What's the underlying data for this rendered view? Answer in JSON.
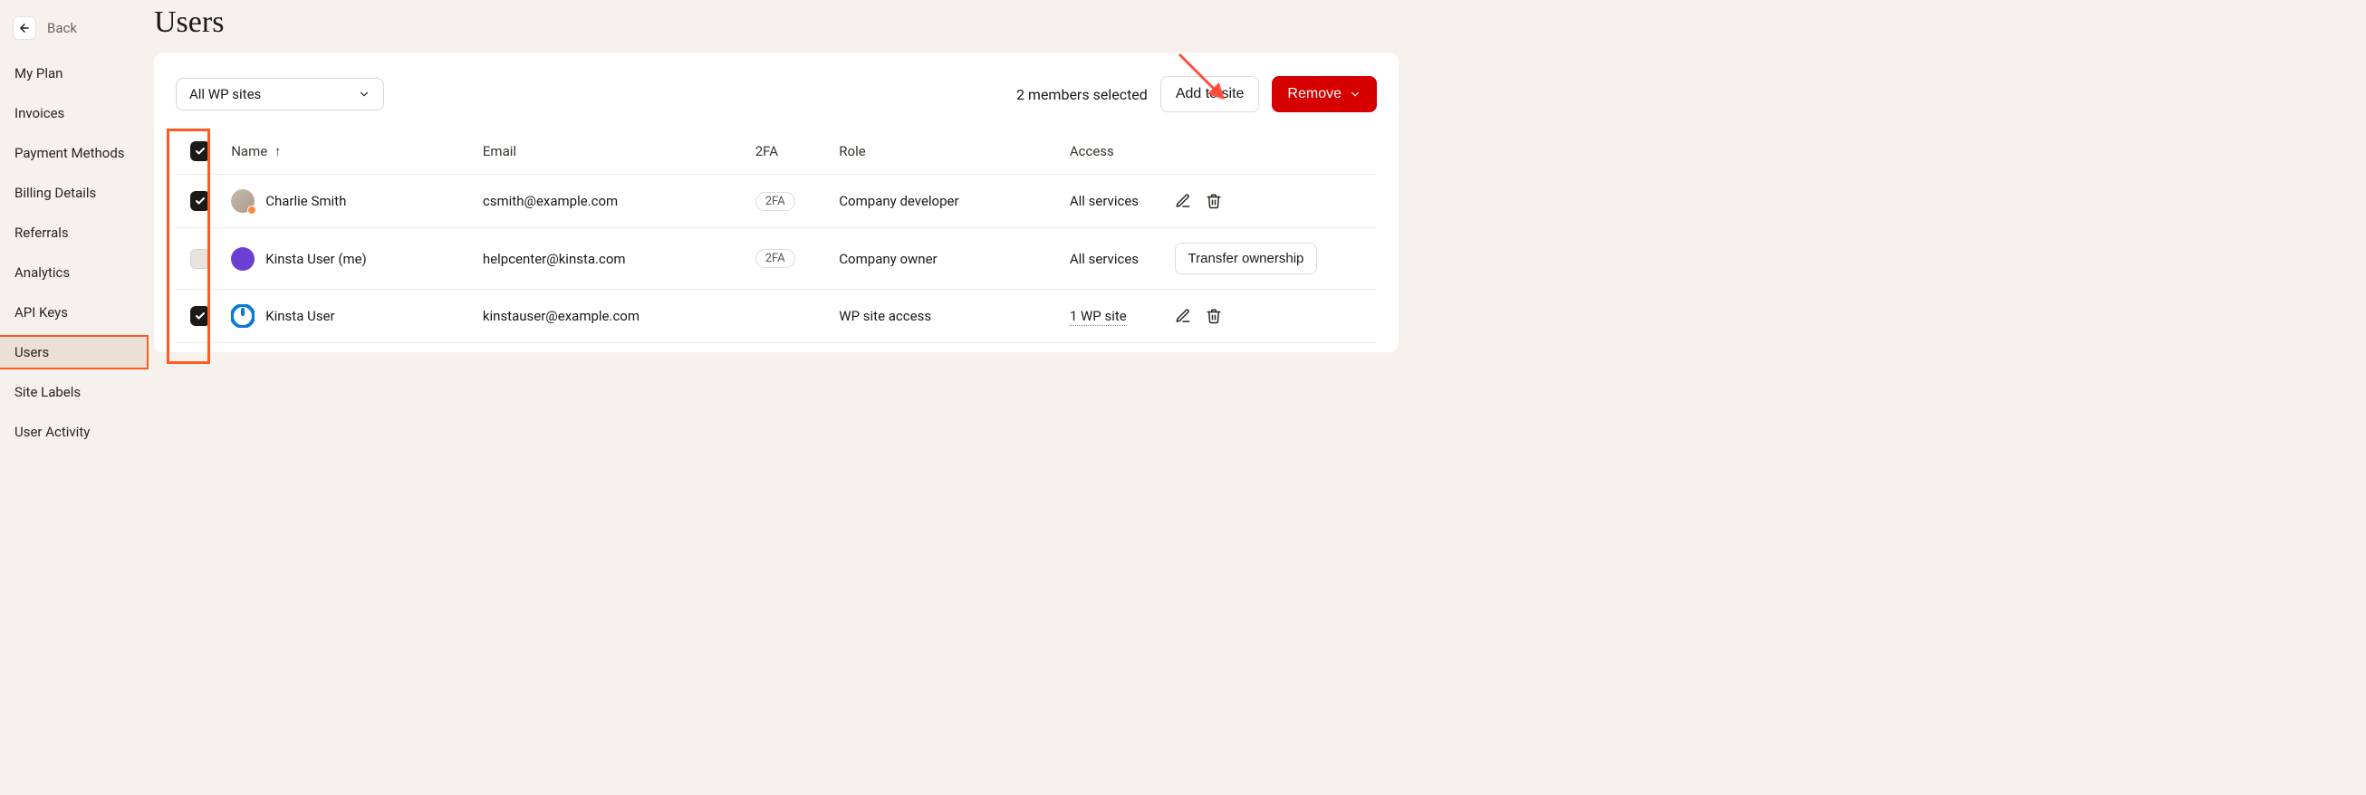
{
  "back": {
    "label": "Back"
  },
  "sidebar": {
    "items": [
      {
        "label": "My Plan"
      },
      {
        "label": "Invoices"
      },
      {
        "label": "Payment Methods"
      },
      {
        "label": "Billing Details"
      },
      {
        "label": "Referrals"
      },
      {
        "label": "Analytics"
      },
      {
        "label": "API Keys"
      },
      {
        "label": "Users"
      },
      {
        "label": "Site Labels"
      },
      {
        "label": "User Activity"
      }
    ],
    "active_index": 7
  },
  "page": {
    "title": "Users"
  },
  "toolbar": {
    "filter_label": "All WP sites",
    "selected_text": "2 members selected",
    "add_label": "Add to site",
    "remove_label": "Remove"
  },
  "table": {
    "columns": {
      "name": "Name",
      "email": "Email",
      "twofa": "2FA",
      "role": "Role",
      "access": "Access"
    },
    "rows": [
      {
        "checked": true,
        "avatar_variant": "gray",
        "avatar_badge": true,
        "name": "Charlie Smith",
        "email": "csmith@example.com",
        "twofa": "2FA",
        "role": "Company developer",
        "access": "All services",
        "actions": "edit-delete"
      },
      {
        "checked": false,
        "avatar_variant": "purple",
        "avatar_badge": false,
        "name": "Kinsta User (me)",
        "email": "helpcenter@kinsta.com",
        "twofa": "2FA",
        "role": "Company owner",
        "access": "All services",
        "actions": "transfer",
        "transfer_label": "Transfer ownership"
      },
      {
        "checked": true,
        "avatar_variant": "blue",
        "avatar_badge": false,
        "name": "Kinsta User",
        "email": "kinstauser@example.com",
        "twofa": "",
        "role": "WP site access",
        "access": "1 WP site",
        "access_dotted": true,
        "actions": "edit-delete"
      }
    ]
  }
}
